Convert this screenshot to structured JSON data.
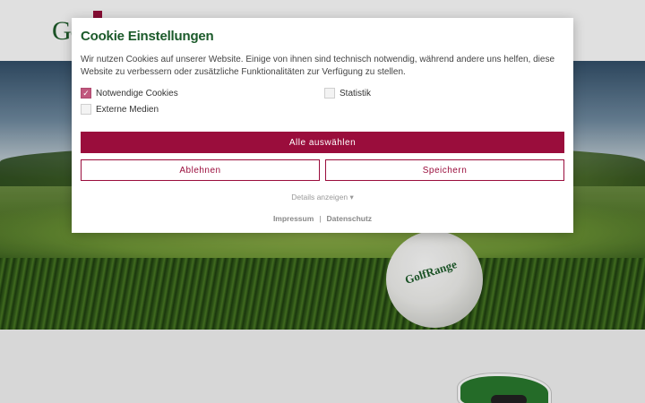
{
  "site": {
    "logo_text": "Go",
    "ball_logo_text": "GolfRange"
  },
  "cookie_modal": {
    "title": "Cookie Einstellungen",
    "description": "Wir nutzen Cookies auf unserer Website. Einige von ihnen sind technisch notwendig, während andere uns helfen, diese Website zu verbessern oder zusätzliche Funktionalitäten zur Verfügung zu stellen.",
    "options": [
      {
        "label": "Notwendige Cookies",
        "checked": true
      },
      {
        "label": "Statistik",
        "checked": false
      },
      {
        "label": "Externe Medien",
        "checked": false
      }
    ],
    "accept_all_label": "Alle auswählen",
    "deny_label": "Ablehnen",
    "save_label": "Speichern",
    "details_label": "Details anzeigen",
    "details_caret": "▾",
    "links": {
      "impressum": "Impressum",
      "separator": "|",
      "datenschutz": "Datenschutz"
    }
  },
  "colors": {
    "brand_green": "#1b5a2a",
    "accent_red": "#9a0d3c",
    "checkbox_checked": "#c0587e"
  }
}
